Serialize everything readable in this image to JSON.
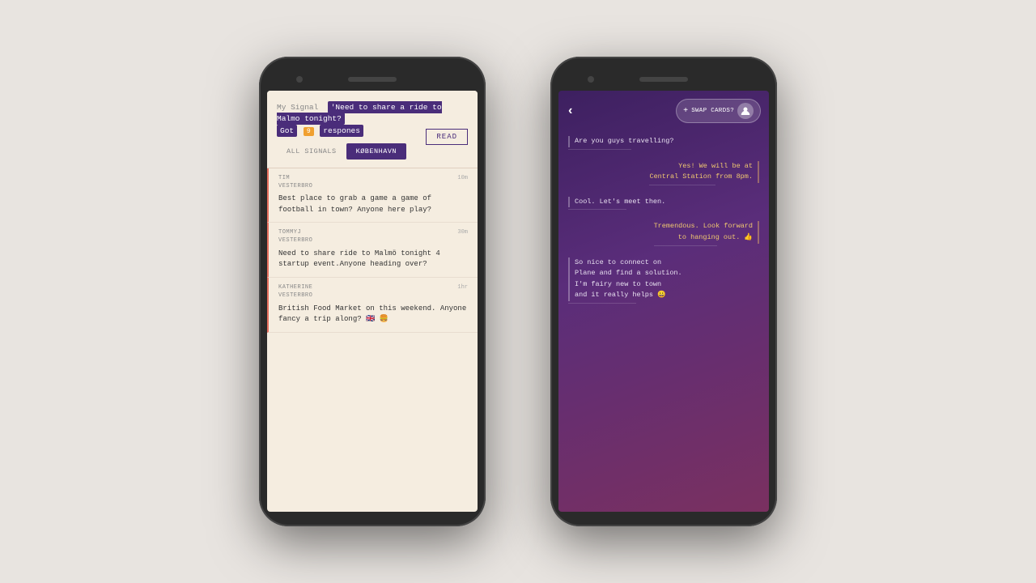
{
  "page": {
    "background": "#e8e4e0"
  },
  "left_phone": {
    "signal_header": {
      "my_signal_label": "My Signal",
      "signal_text": "'Need to share a ride to Malmo tonight?",
      "got_label": "Got",
      "badge_number": "9",
      "responses_label": "respones",
      "read_button": "READ"
    },
    "tabs": {
      "all_signals": "ALL SIGNALS",
      "kobenhavn": "KØBENHAVN"
    },
    "signals": [
      {
        "name": "TIM",
        "location": "VESTERBRO",
        "time": "10m",
        "text": "Best place to grab a game a game of football in town? Anyone here play?"
      },
      {
        "name": "TOMMYJ",
        "location": "VESTERBRO",
        "time": "30m",
        "text": "Need to share ride to Malmö tonight 4 startup event.Anyone heading over?"
      },
      {
        "name": "KATHERINE",
        "location": "VESTERBRO",
        "time": "1hr",
        "text": "British Food Market on this weekend. Anyone fancy a trip along? 🇬🇧 🍔"
      }
    ]
  },
  "right_phone": {
    "header": {
      "back_icon": "‹",
      "plus_icon": "+",
      "swap_label": "SWAP CARDS?",
      "avatar_icon": "👤"
    },
    "messages": [
      {
        "type": "received",
        "text": "Are you guys travelling?"
      },
      {
        "type": "sent",
        "text": "Yes! We will be at\nCentral Station from 8pm."
      },
      {
        "type": "received",
        "text": "Cool. Let's meet then."
      },
      {
        "type": "sent",
        "text": "Tremendous. Look forward\nto hanging out. 👍"
      },
      {
        "type": "received",
        "text": "So nice to connect on\nPlane and find a solution.\nI'm fairy new to town\nand it really helps 😀"
      }
    ]
  }
}
